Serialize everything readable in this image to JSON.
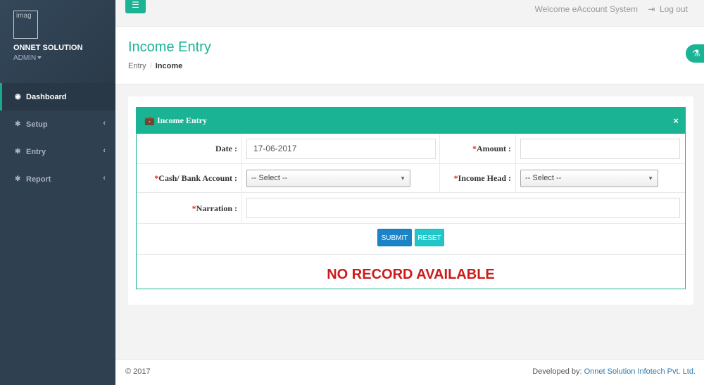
{
  "sidebar": {
    "avatar_alt": "imag",
    "company": "ONNET SOLUTION",
    "role": "ADMIN",
    "items": [
      {
        "label": "Dashboard",
        "icon": "dashboard-icon"
      },
      {
        "label": "Setup",
        "icon": "gear-icon"
      },
      {
        "label": "Entry",
        "icon": "gear-icon"
      },
      {
        "label": "Report",
        "icon": "gear-icon"
      }
    ]
  },
  "topbar": {
    "menu_icon": "☰",
    "welcome": "Welcome eAccount System",
    "logout": "Log out"
  },
  "heading": {
    "title": "Income Entry",
    "breadcrumb": [
      "Entry",
      "Income"
    ]
  },
  "panel": {
    "title": "Income Entry",
    "close": "×"
  },
  "form": {
    "date_label": "Date :",
    "date_value": "17-06-2017",
    "amount_label": "Amount :",
    "amount_value": "",
    "account_label": "Cash/ Bank Account :",
    "account_selected": "-- Select --",
    "income_head_label": "Income Head :",
    "income_head_selected": "-- Select --",
    "narration_label": "Narration :",
    "narration_value": "",
    "required_mark": "*",
    "submit_label": "SUBMIT",
    "reset_label": "RESET"
  },
  "result": {
    "message": "NO RECORD AVAILABLE"
  },
  "footer": {
    "copyright": "© 2017",
    "developed_by": "Developed by:",
    "developer": "Onnet Solution Infotech Pvt. Ltd."
  },
  "colors": {
    "accent": "#1ab394",
    "sidebar": "#2f4050",
    "submit": "#1c84c6",
    "reset": "#23c6c8",
    "alert": "#cc1b1b"
  }
}
